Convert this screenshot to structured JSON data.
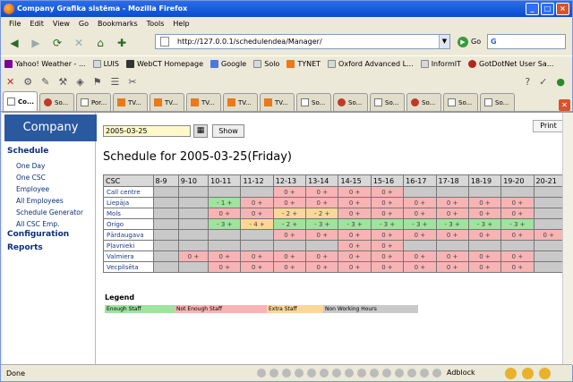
{
  "window": {
    "title": "Company Grafika sistēma - Mozilla Firefox"
  },
  "menu": [
    "File",
    "Edit",
    "View",
    "Go",
    "Bookmarks",
    "Tools",
    "Help"
  ],
  "nav": {
    "url": "http://127.0.0.1/schedulendea/Manager/",
    "go_label": "Go",
    "search_value": "G"
  },
  "bookmarks": [
    "Yahoo! Weather - ...",
    "LUIS",
    "WebCT Homepage",
    "Google",
    "Solo",
    "TYNET",
    "Oxford Advanced L...",
    "InformIT",
    "GotDotNet User Sa..."
  ],
  "tabs": [
    "Co...",
    "So...",
    "Por...",
    "TV...",
    "TV...",
    "TV...",
    "TV...",
    "TV...",
    "So...",
    "So...",
    "So...",
    "So...",
    "So...",
    "So..."
  ],
  "sidebar": {
    "logo": "Company",
    "sections": [
      {
        "label": "Schedule",
        "items": [
          "One Day",
          "One CSC",
          "Employee",
          "All Employees",
          "Schedule Generator",
          "All CSC Emp."
        ]
      },
      {
        "label": "Configuration",
        "items": []
      },
      {
        "label": "Reports",
        "items": []
      }
    ]
  },
  "main": {
    "date_value": "2005-03-25",
    "show_label": "Show",
    "print_label": "Print",
    "title": "Schedule for 2005-03-25(Friday)",
    "columns": [
      "CSC",
      "8-9",
      "9-10",
      "10-11",
      "11-12",
      "12-13",
      "13-14",
      "14-15",
      "15-16",
      "16-17",
      "17-18",
      "18-19",
      "19-20",
      "20-21"
    ],
    "rows": [
      {
        "name": "Call centre",
        "cells": [
          [
            "g",
            ""
          ],
          [
            "g",
            ""
          ],
          [
            "g",
            ""
          ],
          [
            "g",
            ""
          ],
          [
            "r",
            "0 +"
          ],
          [
            "r",
            "0 +"
          ],
          [
            "r",
            "0 +"
          ],
          [
            "r",
            "0 +"
          ],
          [
            "g",
            ""
          ],
          [
            "g",
            ""
          ],
          [
            "g",
            ""
          ],
          [
            "g",
            ""
          ],
          [
            "g",
            ""
          ]
        ]
      },
      {
        "name": "Liepāja",
        "cells": [
          [
            "g",
            ""
          ],
          [
            "g",
            ""
          ],
          [
            "n",
            "- 1 +"
          ],
          [
            "r",
            "0 +"
          ],
          [
            "r",
            "0 +"
          ],
          [
            "r",
            "0 +"
          ],
          [
            "r",
            "0 +"
          ],
          [
            "r",
            "0 +"
          ],
          [
            "r",
            "0 +"
          ],
          [
            "r",
            "0 +"
          ],
          [
            "r",
            "0 +"
          ],
          [
            "r",
            "0 +"
          ],
          [
            "g",
            ""
          ]
        ]
      },
      {
        "name": "Mols",
        "cells": [
          [
            "g",
            ""
          ],
          [
            "g",
            ""
          ],
          [
            "r",
            "0 +"
          ],
          [
            "r",
            "0 +"
          ],
          [
            "y",
            "- 2 +"
          ],
          [
            "y",
            "- 2 +"
          ],
          [
            "r",
            "0 +"
          ],
          [
            "r",
            "0 +"
          ],
          [
            "r",
            "0 +"
          ],
          [
            "r",
            "0 +"
          ],
          [
            "r",
            "0 +"
          ],
          [
            "r",
            "0 +"
          ],
          [
            "g",
            ""
          ]
        ]
      },
      {
        "name": "Origo",
        "cells": [
          [
            "g",
            ""
          ],
          [
            "g",
            ""
          ],
          [
            "n",
            "- 3 +"
          ],
          [
            "y",
            "- 4 +"
          ],
          [
            "n",
            "- 2 +"
          ],
          [
            "n",
            "- 3 +"
          ],
          [
            "n",
            "- 3 +"
          ],
          [
            "n",
            "- 3 +"
          ],
          [
            "n",
            "- 3 +"
          ],
          [
            "n",
            "- 3 +"
          ],
          [
            "n",
            "- 3 +"
          ],
          [
            "n",
            "- 3 +"
          ],
          [
            "g",
            ""
          ]
        ]
      },
      {
        "name": "Pārdaugava",
        "cells": [
          [
            "g",
            ""
          ],
          [
            "g",
            ""
          ],
          [
            "g",
            ""
          ],
          [
            "g",
            ""
          ],
          [
            "r",
            "0 +"
          ],
          [
            "r",
            "0 +"
          ],
          [
            "r",
            "0 +"
          ],
          [
            "r",
            "0 +"
          ],
          [
            "r",
            "0 +"
          ],
          [
            "r",
            "0 +"
          ],
          [
            "r",
            "0 +"
          ],
          [
            "r",
            "0 +"
          ],
          [
            "r",
            "0 +"
          ]
        ]
      },
      {
        "name": "Pļavnieki",
        "cells": [
          [
            "g",
            ""
          ],
          [
            "g",
            ""
          ],
          [
            "g",
            ""
          ],
          [
            "g",
            ""
          ],
          [
            "g",
            ""
          ],
          [
            "g",
            ""
          ],
          [
            "r",
            "0 +"
          ],
          [
            "r",
            "0 +"
          ],
          [
            "g",
            ""
          ],
          [
            "g",
            ""
          ],
          [
            "g",
            ""
          ],
          [
            "g",
            ""
          ],
          [
            "g",
            ""
          ]
        ]
      },
      {
        "name": "Valmiera",
        "cells": [
          [
            "g",
            ""
          ],
          [
            "r",
            "0 +"
          ],
          [
            "r",
            "0 +"
          ],
          [
            "r",
            "0 +"
          ],
          [
            "r",
            "0 +"
          ],
          [
            "r",
            "0 +"
          ],
          [
            "r",
            "0 +"
          ],
          [
            "r",
            "0 +"
          ],
          [
            "r",
            "0 +"
          ],
          [
            "r",
            "0 +"
          ],
          [
            "r",
            "0 +"
          ],
          [
            "r",
            "0 +"
          ],
          [
            "g",
            ""
          ]
        ]
      },
      {
        "name": "Vecpilsēta",
        "cells": [
          [
            "g",
            ""
          ],
          [
            "g",
            ""
          ],
          [
            "r",
            "0 +"
          ],
          [
            "r",
            "0 +"
          ],
          [
            "r",
            "0 +"
          ],
          [
            "r",
            "0 +"
          ],
          [
            "r",
            "0 +"
          ],
          [
            "r",
            "0 +"
          ],
          [
            "r",
            "0 +"
          ],
          [
            "r",
            "0 +"
          ],
          [
            "r",
            "0 +"
          ],
          [
            "r",
            "0 +"
          ],
          [
            "g",
            ""
          ]
        ]
      }
    ],
    "legend_title": "Legend",
    "legend": [
      {
        "label": "Enough Staff",
        "color": "#9fe39f"
      },
      {
        "label": "Not Enough Staff",
        "color": "#f8b4b4"
      },
      {
        "label": "Extra Staff",
        "color": "#fcd79a"
      },
      {
        "label": "Non Working Hours",
        "color": "#c9c9c9"
      }
    ]
  },
  "status": {
    "text": "Done",
    "adblock": "Adblock"
  }
}
